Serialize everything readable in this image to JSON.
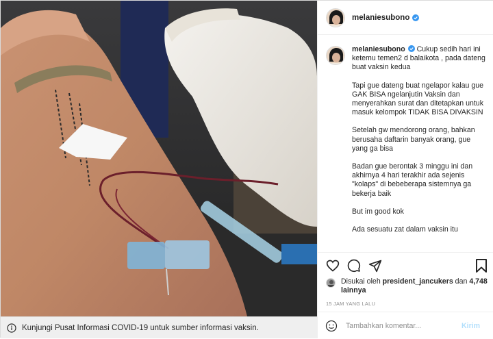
{
  "post": {
    "username": "melaniesubono",
    "caption_paragraphs": [
      "Cukup sedih hari ini ketemu temen2 d balaikota , pada dateng buat vaksin kedua",
      "Tapi gue dateng buat ngelapor kalau gue GAK BISA ngelanjutin Vaksin dan menyerahkan surat dan ditetapkan untuk masuk kelompok TIDAK BISA DIVAKSIN",
      "Setelah gw mendorong orang, bahkan berusaha daftarin banyak orang, gue yang ga bisa",
      "Badan gue berontak 3 minggu ini dan akhirnya 4 hari terakhir ada sejenis \"kolaps\" di bebeberapa sistemnya ga bekerja baik",
      "But im good kok",
      "Ada sesuatu zat dalam vaksin itu"
    ],
    "likes_prefix": "Disukai oleh",
    "liked_by": "president_jancukers",
    "likes_joiner": "dan",
    "likes_count": "4,748 lainnya",
    "timestamp": "15 JAM YANG LALU"
  },
  "comment": {
    "placeholder": "Tambahkan komentar...",
    "post_label": "Kirim"
  },
  "info_banner": {
    "text": "Kunjungi Pusat Informasi COVID-19 untuk sumber informasi vaksin."
  },
  "icons": {
    "like": "heart-icon",
    "comment": "comment-icon",
    "share": "paper-plane-icon",
    "save": "bookmark-icon",
    "verified": "verified-badge-icon",
    "emoji": "smiley-icon",
    "info": "info-icon"
  },
  "colors": {
    "verified": "#3897f0",
    "post_disabled": "#b2dffc",
    "muted": "#8e8e8e"
  }
}
